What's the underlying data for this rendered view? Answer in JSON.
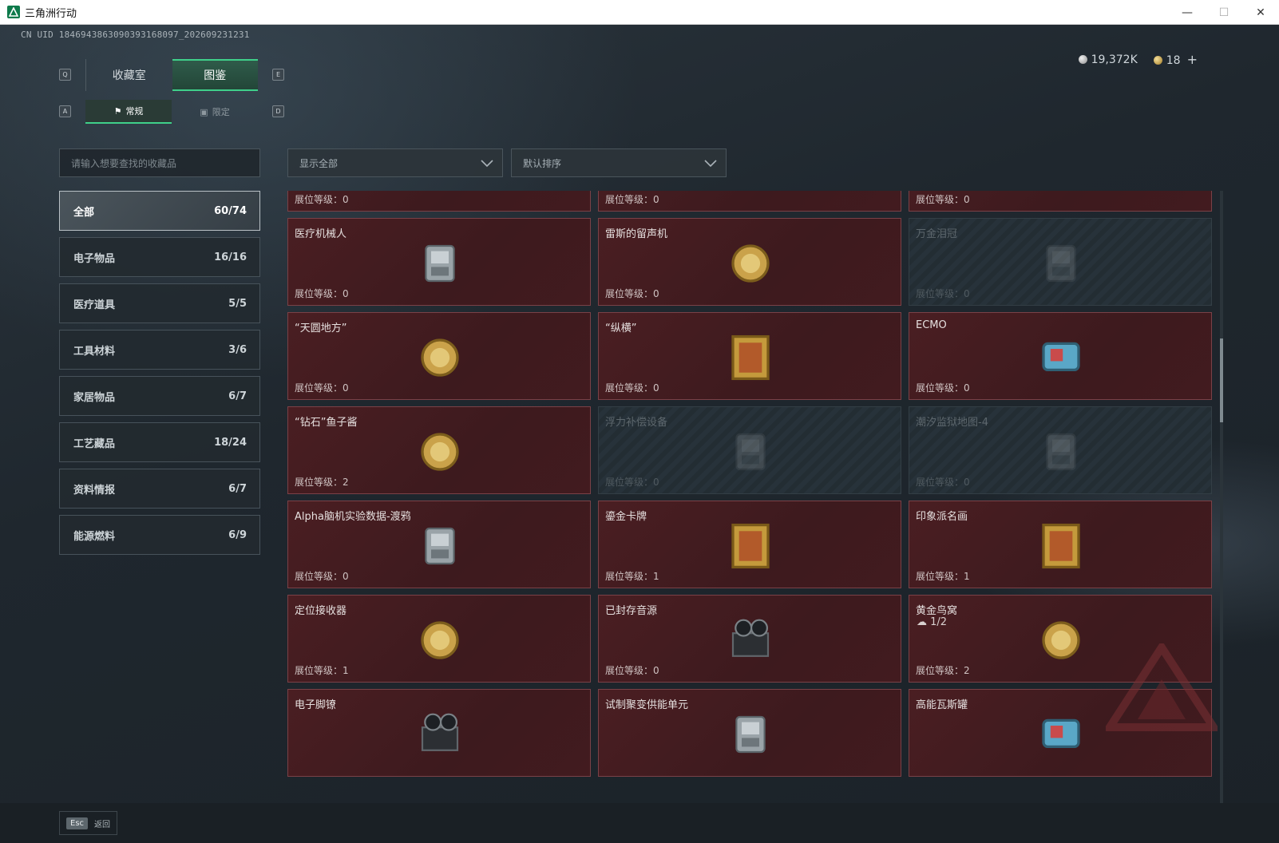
{
  "window": {
    "title": "三角洲行动"
  },
  "uid": "CN UID 1846943863090393168097_202609231231",
  "currency": {
    "silver": "19,372K",
    "gold": "18",
    "plus": "+"
  },
  "tabs": [
    {
      "label": "收藏室",
      "active": false
    },
    {
      "label": "图鉴",
      "active": true
    }
  ],
  "subtabs": [
    {
      "label": "常规",
      "active": true
    },
    {
      "label": "限定",
      "active": false
    }
  ],
  "keys": {
    "q": "Q",
    "e": "E",
    "a": "A",
    "d": "D"
  },
  "search": {
    "placeholder": "请输入想要查找的收藏品"
  },
  "filters": {
    "show": "显示全部",
    "sort": "默认排序"
  },
  "categories": [
    {
      "label": "全部",
      "count": "60/74",
      "active": true
    },
    {
      "label": "电子物品",
      "count": "16/16"
    },
    {
      "label": "医疗道具",
      "count": "5/5"
    },
    {
      "label": "工具材料",
      "count": "3/6"
    },
    {
      "label": "家居物品",
      "count": "6/7"
    },
    {
      "label": "工艺藏品",
      "count": "18/24"
    },
    {
      "label": "资料情报",
      "count": "6/7"
    },
    {
      "label": "能源燃料",
      "count": "6/9"
    }
  ],
  "items": [
    {
      "name": "",
      "level": "展位等级：0",
      "icon": "capsule-device-icon",
      "locked": false
    },
    {
      "name": "",
      "level": "展位等级：0",
      "icon": "server-case-icon",
      "locked": false
    },
    {
      "name": "",
      "level": "展位等级：0",
      "icon": "battery-pack-icon",
      "locked": false
    },
    {
      "name": "医疗机械人",
      "level": "展位等级：0",
      "icon": "medical-robot-icon",
      "locked": false
    },
    {
      "name": "雷斯的留声机",
      "level": "展位等级：0",
      "icon": "gramophone-icon",
      "locked": false
    },
    {
      "name": "万金泪冠",
      "level": "展位等级：0",
      "icon": "crown-icon",
      "locked": true
    },
    {
      "name": "“天圆地方”",
      "level": "展位等级：0",
      "icon": "armillary-sphere-icon",
      "locked": false
    },
    {
      "name": "“纵横”",
      "level": "展位等级：0",
      "icon": "chess-box-icon",
      "locked": false
    },
    {
      "name": "ECMO",
      "level": "展位等级：0",
      "icon": "ecmo-machine-icon",
      "locked": false
    },
    {
      "name": "“钻石”鱼子酱",
      "level": "展位等级：2",
      "icon": "caviar-tin-icon",
      "locked": false
    },
    {
      "name": "浮力补偿设备",
      "level": "展位等级：0",
      "icon": "buoyancy-device-icon",
      "locked": true
    },
    {
      "name": "潮汐监狱地图-4",
      "level": "展位等级：0",
      "icon": "map-icon",
      "locked": true
    },
    {
      "name": "Alpha脑机实验数据-渡鸦",
      "level": "展位等级：0",
      "icon": "data-canister-icon",
      "locked": false
    },
    {
      "name": "鎏金卡牌",
      "level": "展位等级：1",
      "icon": "gilded-card-icon",
      "locked": false
    },
    {
      "name": "印象派名画",
      "level": "展位等级：1",
      "icon": "painting-icon",
      "locked": false
    },
    {
      "name": "定位接收器",
      "level": "展位等级：1",
      "icon": "receiver-icon",
      "locked": false
    },
    {
      "name": "已封存音源",
      "level": "展位等级：0",
      "icon": "reel-recorder-icon",
      "locked": false
    },
    {
      "name": "黄金鸟窝",
      "level": "展位等级：2",
      "icon": "golden-nest-icon",
      "locked": false,
      "extra": "1/2"
    },
    {
      "name": "电子脚镣",
      "level": "",
      "icon": "ankle-monitor-icon",
      "locked": false
    },
    {
      "name": "试制聚变供能单元",
      "level": "",
      "icon": "fusion-unit-icon",
      "locked": false
    },
    {
      "name": "高能瓦斯罐",
      "level": "",
      "icon": "gas-canister-icon",
      "locked": false
    }
  ],
  "bottom": {
    "key": "Esc",
    "label": "返回"
  },
  "colors": {
    "accent": "#3fd08a",
    "card": "#4a1e22",
    "card_border": "#7a4147"
  }
}
